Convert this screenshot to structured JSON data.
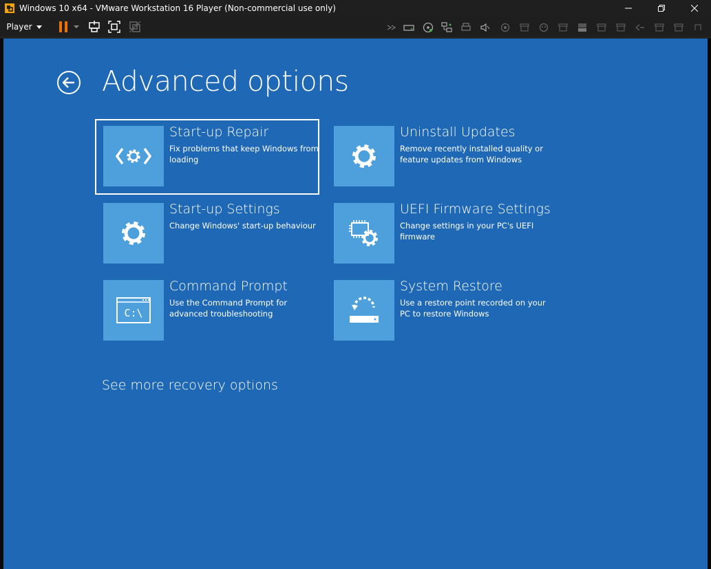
{
  "titlebar": {
    "title": "Windows 10 x64 - VMware Workstation 16 Player (Non-commercial use only)",
    "icon": "vmware-player-icon",
    "minimize": "minimize-icon",
    "maximize": "maximize-icon",
    "close": "close-icon"
  },
  "toolbar": {
    "player_label": "Player",
    "icons": [
      "pause-icon",
      "send-ctrl-alt-del-icon",
      "fullscreen-icon",
      "unity-icon"
    ],
    "devices": [
      "network-icon",
      "hard-disk-icon",
      "cd-dvd-icon",
      "network-adapter-icon",
      "printer-icon",
      "sound-icon",
      "usb-icon",
      "usb-icon",
      "usb-icon",
      "usb-icon",
      "hard-disk-icon",
      "usb-icon",
      "usb-icon",
      "usb-icon",
      "usb-icon",
      "usb-icon"
    ]
  },
  "screen": {
    "title": "Advanced options",
    "tiles": [
      {
        "title": "Start-up Repair",
        "desc": "Fix problems that keep Windows from loading",
        "icon": "startup-repair-icon"
      },
      {
        "title": "Uninstall Updates",
        "desc": "Remove recently installed quality or feature updates from Windows",
        "icon": "gear-icon"
      },
      {
        "title": "Start-up Settings",
        "desc": "Change Windows' start-up behaviour",
        "icon": "gear-icon"
      },
      {
        "title": "UEFI Firmware Settings",
        "desc": "Change settings in your PC's UEFI firmware",
        "icon": "firmware-chip-gear-icon"
      },
      {
        "title": "Command Prompt",
        "desc": "Use the Command Prompt for advanced troubleshooting",
        "icon": "command-prompt-icon",
        "glyph": "C:\\"
      },
      {
        "title": "System Restore",
        "desc": "Use a restore point recorded on your PC to restore Windows",
        "icon": "system-restore-icon"
      }
    ],
    "more_link": "See more recovery options"
  },
  "colors": {
    "background": "#1f68b5",
    "tile_icon_bg": "#4ea0dc",
    "accent_pause": "#e8710a"
  }
}
